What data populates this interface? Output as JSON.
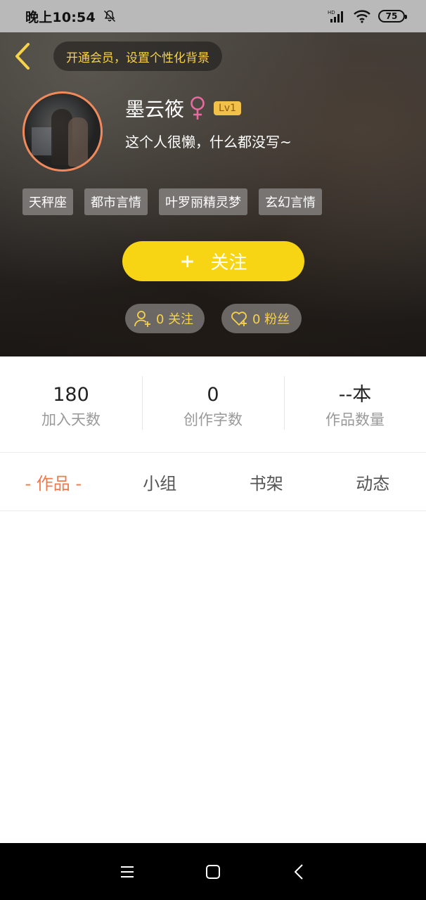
{
  "status_bar": {
    "time": "晚上10:54",
    "battery": "75",
    "icons": [
      "mute-bell-icon",
      "signal-hd-icon",
      "wifi-icon",
      "battery-icon"
    ]
  },
  "header": {
    "back_icon": "chevron-left-icon",
    "vip_prompt": "开通会员，设置个性化背景",
    "name": "墨云筱",
    "gender_icon": "female-icon",
    "level": "Lv1",
    "bio": "这个人很懒，什么都没写~",
    "tags": [
      "天秤座",
      "都市言情",
      "叶罗丽精灵梦",
      "玄幻言情"
    ],
    "follow_button": {
      "plus": "+",
      "label": "关注"
    },
    "following": {
      "icon": "add-user-icon",
      "text": "0 关注"
    },
    "fans": {
      "icon": "heart-plus-icon",
      "text": "0 粉丝"
    }
  },
  "stats": [
    {
      "value": "180",
      "label": "加入天数"
    },
    {
      "value": "0",
      "label": "创作字数"
    },
    {
      "value": "--本",
      "label": "作品数量"
    }
  ],
  "tabs": [
    {
      "label": "- 作品 -",
      "active": true
    },
    {
      "label": "小组",
      "active": false
    },
    {
      "label": "书架",
      "active": false
    },
    {
      "label": "动态",
      "active": false
    }
  ],
  "nav_bar": {
    "icons": [
      "menu-icon",
      "home-square-icon",
      "back-triangle-icon"
    ]
  },
  "colors": {
    "accent_yellow": "#f7d514",
    "active_tab": "#f07a4f",
    "avatar_border": "#f08a5d",
    "level_badge": "#f2c14a"
  }
}
